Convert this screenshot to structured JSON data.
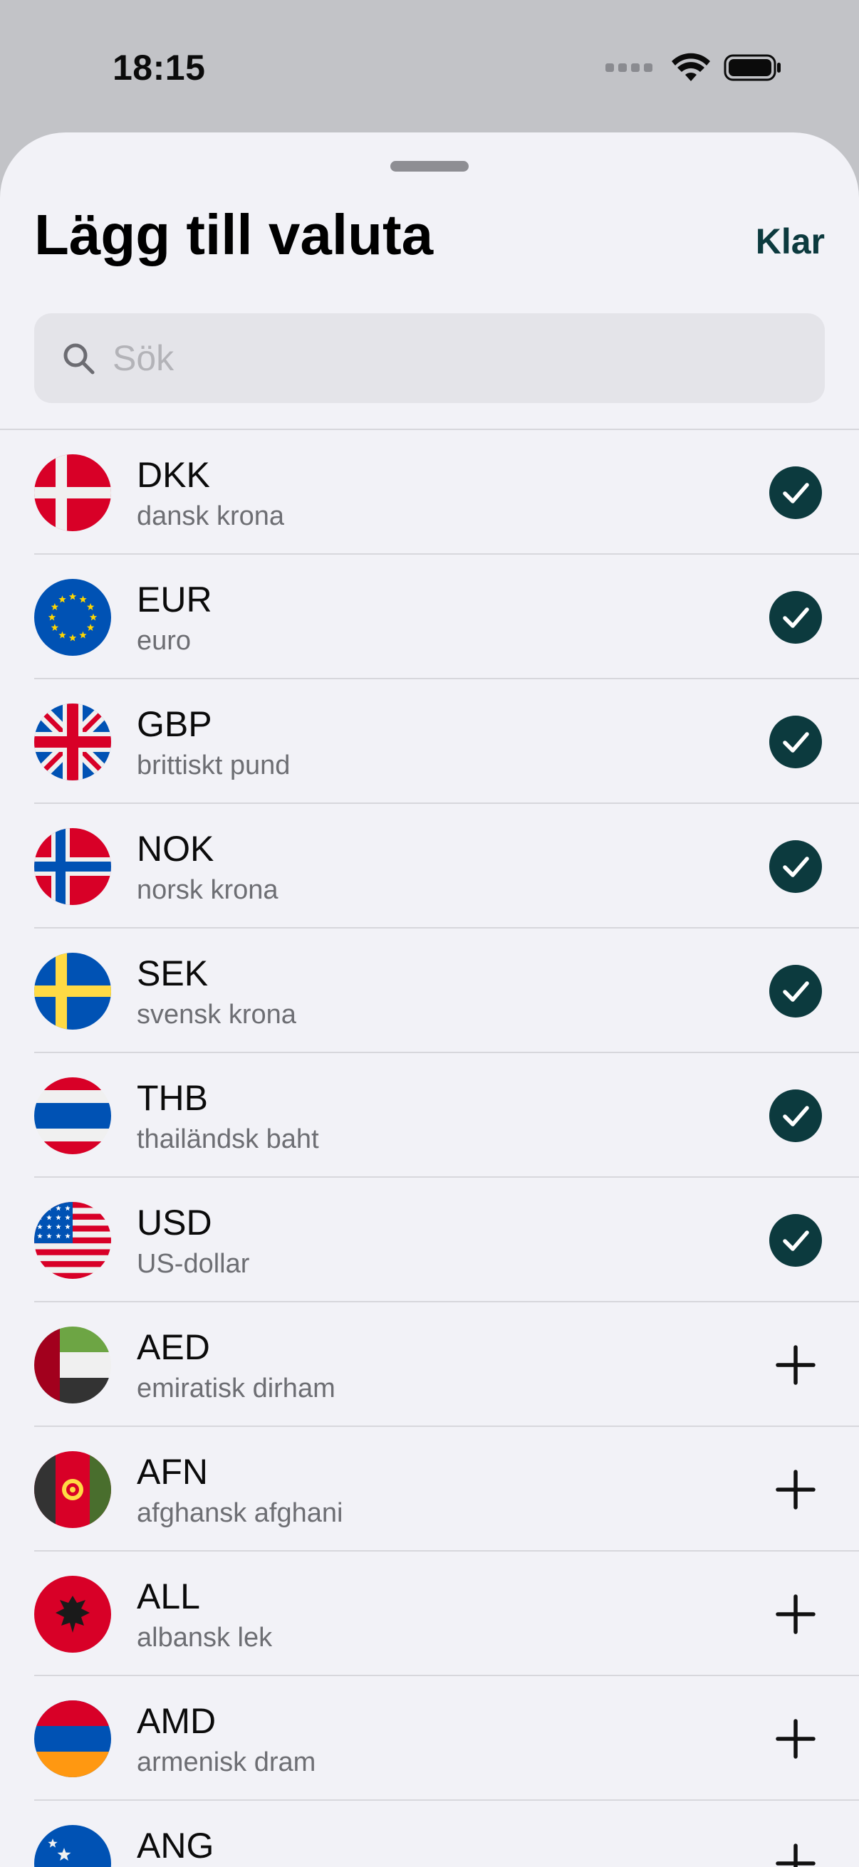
{
  "status_bar": {
    "time": "18:15"
  },
  "sheet": {
    "title": "Lägg till valuta",
    "done_label": "Klar",
    "search": {
      "placeholder": "Sök",
      "value": ""
    }
  },
  "accent_color": "#0c3a3e",
  "currencies": [
    {
      "code": "DKK",
      "name": "dansk krona",
      "selected": true,
      "flag": "denmark"
    },
    {
      "code": "EUR",
      "name": "euro",
      "selected": true,
      "flag": "european-union"
    },
    {
      "code": "GBP",
      "name": "brittiskt pund",
      "selected": true,
      "flag": "united-kingdom"
    },
    {
      "code": "NOK",
      "name": "norsk krona",
      "selected": true,
      "flag": "norway"
    },
    {
      "code": "SEK",
      "name": "svensk krona",
      "selected": true,
      "flag": "sweden"
    },
    {
      "code": "THB",
      "name": "thailändsk baht",
      "selected": true,
      "flag": "thailand"
    },
    {
      "code": "USD",
      "name": "US-dollar",
      "selected": true,
      "flag": "united-states"
    },
    {
      "code": "AED",
      "name": "emiratisk dirham",
      "selected": false,
      "flag": "united-arab-emirates"
    },
    {
      "code": "AFN",
      "name": "afghansk afghani",
      "selected": false,
      "flag": "afghanistan"
    },
    {
      "code": "ALL",
      "name": "albansk lek",
      "selected": false,
      "flag": "albania"
    },
    {
      "code": "AMD",
      "name": "armenisk dram",
      "selected": false,
      "flag": "armenia"
    },
    {
      "code": "ANG",
      "name": "",
      "selected": false,
      "flag": "curacao"
    }
  ]
}
